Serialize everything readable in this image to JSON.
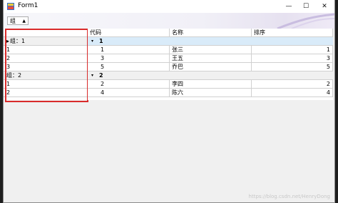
{
  "window": {
    "title": "Form1",
    "minimize": "—",
    "maximize": "☐",
    "close": "✕"
  },
  "toolbar": {
    "group_button": "组"
  },
  "left_panel": {
    "rows": [
      {
        "text": "",
        "type": "blank"
      },
      {
        "text": "组：1",
        "type": "group"
      },
      {
        "text": "1",
        "type": "item"
      },
      {
        "text": "2",
        "type": "item"
      },
      {
        "text": "3",
        "type": "item"
      },
      {
        "text": "组：2",
        "type": "group"
      },
      {
        "text": "1",
        "type": "item"
      },
      {
        "text": "2",
        "type": "item"
      }
    ]
  },
  "grid": {
    "columns": [
      "代码",
      "名称",
      "排序"
    ],
    "groups": [
      {
        "key": "1",
        "rows": [
          [
            "1",
            "张三",
            "1"
          ],
          [
            "3",
            "王五",
            "3"
          ],
          [
            "5",
            "乔巴",
            "5"
          ]
        ]
      },
      {
        "key": "2",
        "rows": [
          [
            "2",
            "李四",
            "2"
          ],
          [
            "4",
            "陈六",
            "4"
          ]
        ]
      }
    ]
  },
  "watermark": "https://blog.csdn.net/HenryDong"
}
